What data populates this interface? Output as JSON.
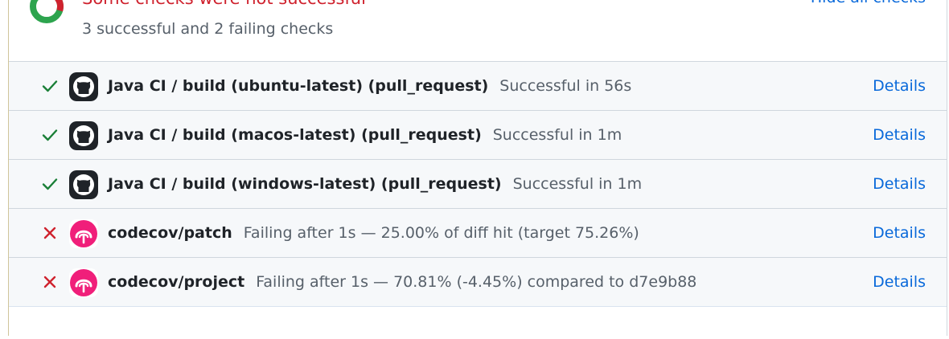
{
  "summary": {
    "title": "Some checks were not successful",
    "subtitle": "3 successful and 2 failing checks",
    "hide_link": "Hide all checks",
    "colors": {
      "success": "#2da44e",
      "failure": "#cf222e"
    }
  },
  "checks": [
    {
      "status": "success",
      "status_icon": "check-icon",
      "app_icon": "github-icon",
      "name": "Java CI / build (ubuntu-latest) (pull_request)",
      "description": "Successful in 56s",
      "details": "Details"
    },
    {
      "status": "success",
      "status_icon": "check-icon",
      "app_icon": "github-icon",
      "name": "Java CI / build (macos-latest) (pull_request)",
      "description": "Successful in 1m",
      "details": "Details"
    },
    {
      "status": "success",
      "status_icon": "check-icon",
      "app_icon": "github-icon",
      "name": "Java CI / build (windows-latest) (pull_request)",
      "description": "Successful in 1m",
      "details": "Details"
    },
    {
      "status": "failure",
      "status_icon": "x-icon",
      "app_icon": "codecov-icon",
      "name": "codecov/patch",
      "description": "Failing after 1s — 25.00% of diff hit (target 75.26%)",
      "details": "Details"
    },
    {
      "status": "failure",
      "status_icon": "x-icon",
      "app_icon": "codecov-icon",
      "name": "codecov/project",
      "description": "Failing after 1s — 70.81% (-4.45%) compared to d7e9b88",
      "details": "Details"
    }
  ]
}
